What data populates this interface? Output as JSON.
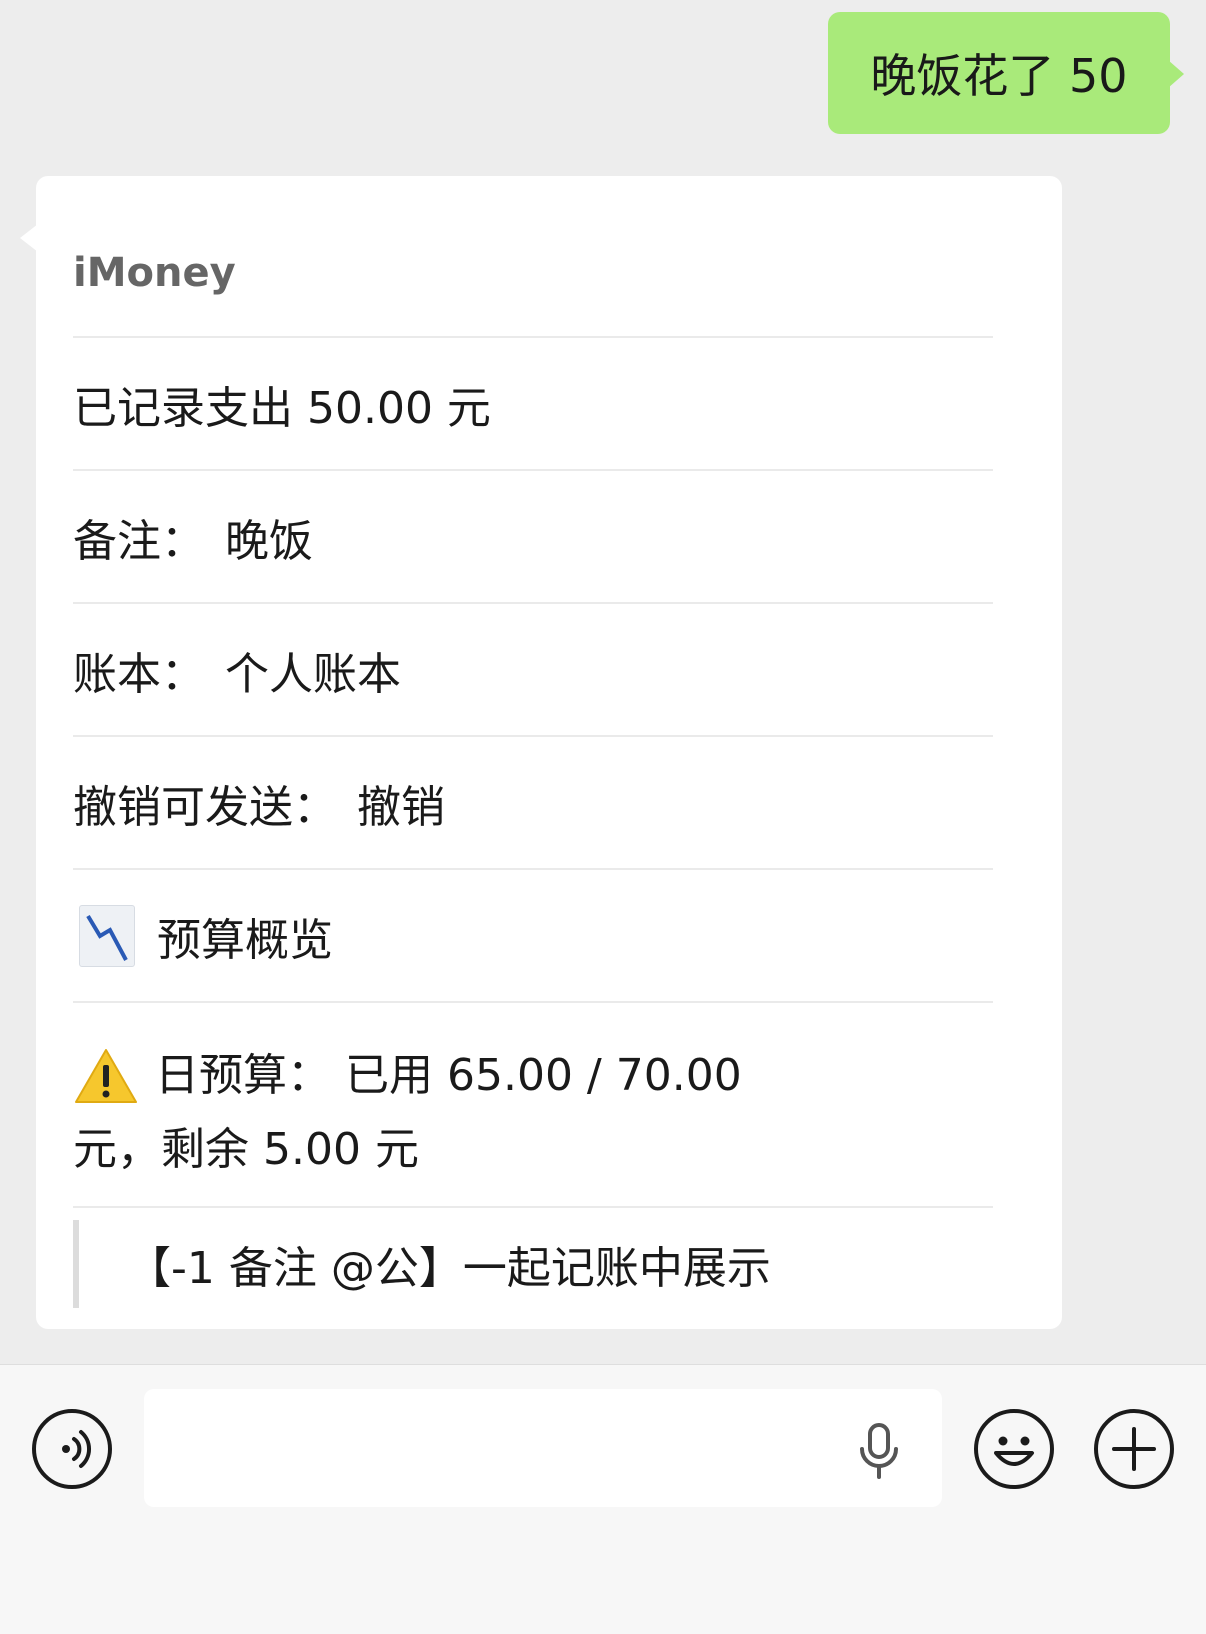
{
  "outgoing_message": "晚饭花了 50",
  "card": {
    "sender": "iMoney",
    "rows": [
      {
        "key": "已记录支出 50.00 元",
        "value": ""
      },
      {
        "key": "备注：",
        "value": "晚饭"
      },
      {
        "key": "账本：",
        "value": "个人账本"
      },
      {
        "key": "撤销可发送：",
        "value": "撤销"
      }
    ],
    "overview_label": "预算概览",
    "overview_icon": "chart-decreasing-icon",
    "budget_line1": "日预算：  已用 65.00 / 70.00",
    "budget_line2": "元，剩余 5.00 元",
    "budget_icon": "warning-icon",
    "footer_quote": "【-1 备注 @公】一起记账中展示"
  },
  "input_bar": {
    "voice_icon": "voice-mode-icon",
    "mic_icon": "microphone-icon",
    "emoji_icon": "emoji-icon",
    "plus_icon": "plus-icon"
  },
  "colors": {
    "outgoing_bubble": "#a9ea7a",
    "background": "#ededed",
    "warning": "#f6c72d"
  }
}
